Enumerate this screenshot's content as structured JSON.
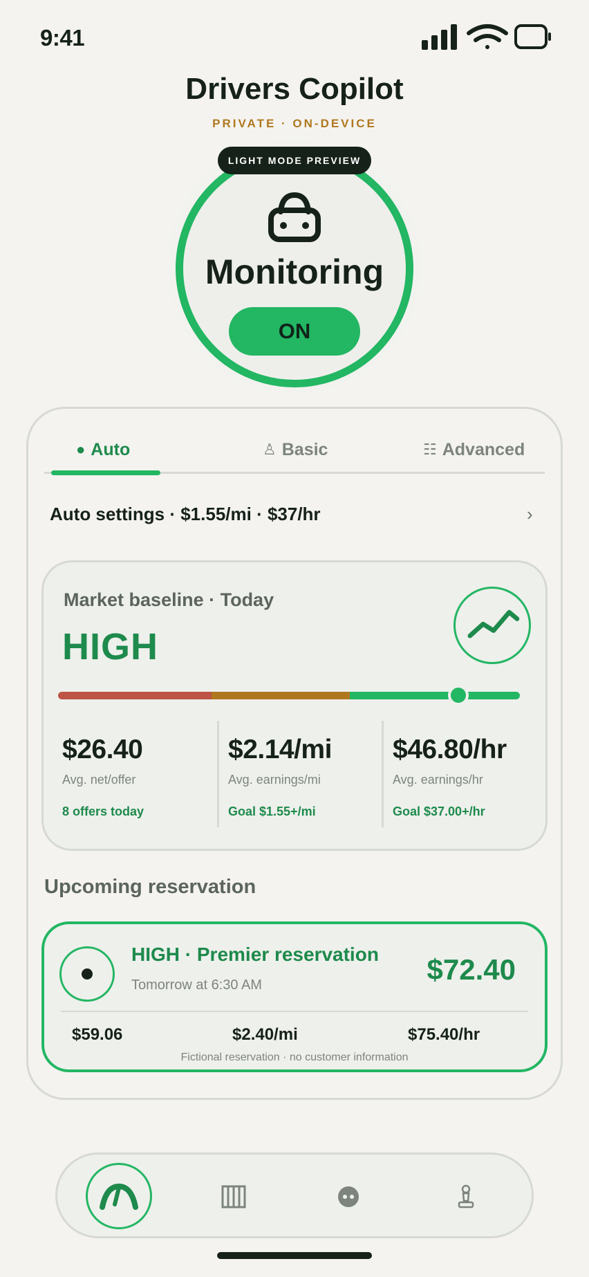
{
  "status_bar": {
    "time": "9:41"
  },
  "header": {
    "title": "Drivers Copilot",
    "subtitle": "PRIVATE · ON-DEVICE"
  },
  "monitor": {
    "preview_badge": "LIGHT MODE PREVIEW",
    "label": "Monitoring",
    "toggle_label": "ON",
    "car_icon": "car-icon"
  },
  "tabs": [
    {
      "label": "Auto",
      "icon": "●",
      "active": true
    },
    {
      "label": "Basic",
      "icon": "♙",
      "active": false
    },
    {
      "label": "Advanced",
      "icon": "☷",
      "active": false
    }
  ],
  "auto_settings": {
    "text": "Auto settings · $1.55/mi · $37/hr",
    "chevron": "›"
  },
  "market": {
    "title": "Market baseline · Today",
    "level": "HIGH",
    "gauge_position": 0.87,
    "stats": [
      {
        "value": "$26.40",
        "label": "Avg. net/offer",
        "note": "8 offers today"
      },
      {
        "value": "$2.14/mi",
        "label": "Avg. earnings/mi",
        "note": "Goal $1.55+/mi"
      },
      {
        "value": "$46.80/hr",
        "label": "Avg. earnings/hr",
        "note": "Goal $37.00+/hr"
      }
    ]
  },
  "upcoming": {
    "heading": "Upcoming reservation",
    "title": "HIGH · Premier reservation",
    "time": "Tomorrow at 6:30 AM",
    "price": "$72.40",
    "stats": [
      "$59.06",
      "$2.40/mi",
      "$75.40/hr"
    ],
    "note": "Fictional reservation · no customer information"
  },
  "colors": {
    "accent": "#23b663",
    "accent_dark": "#1e8a4c",
    "amber": "#b0781e",
    "red": "#bd5445",
    "background": "#f4f3f0"
  }
}
